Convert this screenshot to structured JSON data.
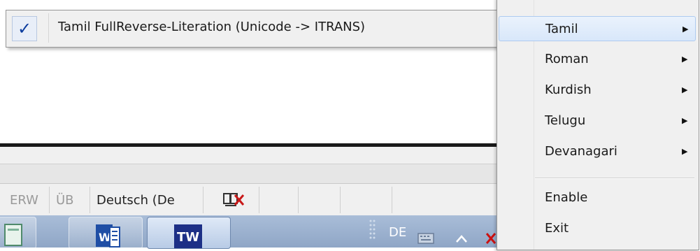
{
  "popup": {
    "checked_item_label": "Tamil FullReverse-Literation (Unicode -> ITRANS)",
    "check_glyph": "✓"
  },
  "status_bar": {
    "erw": "ERW",
    "ub": "ÜB",
    "language": "Deutsch (De",
    "spellcheck_icon": "book-with-x-icon"
  },
  "taskbar": {
    "buttons": [
      {
        "name": "notepad",
        "icon": "notepad-icon"
      },
      {
        "name": "word",
        "icon": "word-icon",
        "text": "W"
      },
      {
        "name": "active-app",
        "icon": "tw-icon",
        "text": "TW",
        "active": true
      }
    ],
    "tray": {
      "language_indicator": "DE",
      "icons": [
        "keyboard-icon",
        "show-hidden-icon",
        "error-icon"
      ]
    }
  },
  "context_menu": {
    "items": [
      {
        "label": "Tamil",
        "submenu": true,
        "highlight": true
      },
      {
        "label": "Roman",
        "submenu": true
      },
      {
        "label": "Kurdish",
        "submenu": true
      },
      {
        "label": "Telugu",
        "submenu": true
      },
      {
        "label": "Devanagari",
        "submenu": true
      },
      {
        "label": "Enable",
        "submenu": false
      },
      {
        "label": "Exit",
        "submenu": false
      }
    ],
    "submenu_arrow": "▶"
  }
}
